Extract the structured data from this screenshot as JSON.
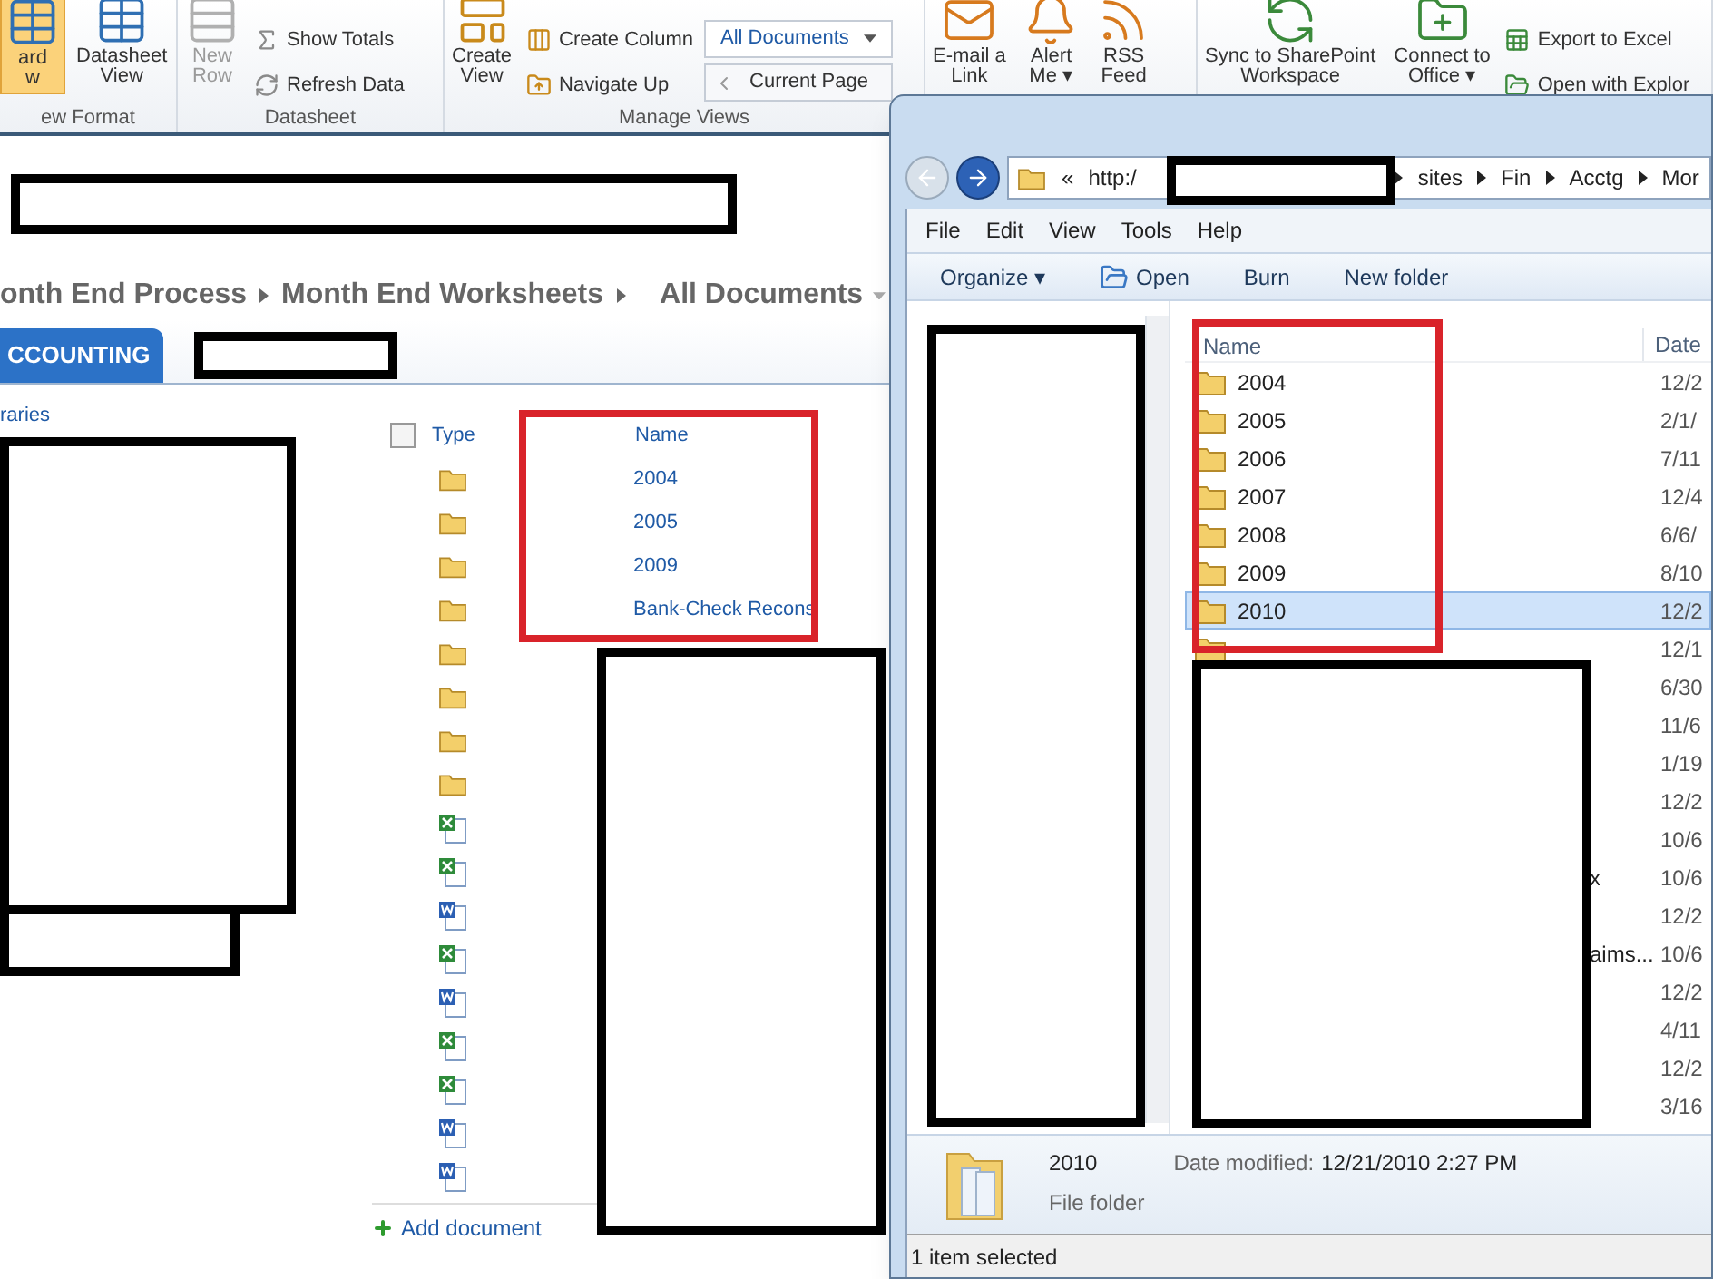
{
  "ribbon": {
    "groups": [
      {
        "label": "ew Format",
        "items": [
          {
            "kind": "large",
            "label": "ard\nw",
            "selected": true
          },
          {
            "kind": "large",
            "label": "Datasheet\nView",
            "selected": false
          }
        ]
      },
      {
        "label": "Datasheet",
        "items": [
          {
            "kind": "large",
            "label": "New\nRow",
            "disabled": true
          },
          {
            "kind": "stack",
            "entries": [
              {
                "label": "Show Totals"
              },
              {
                "label": "Refresh Data"
              }
            ]
          }
        ]
      },
      {
        "label": "Manage Views",
        "items": [
          {
            "kind": "large",
            "label": "Create\nView"
          },
          {
            "kind": "stack",
            "entries": [
              {
                "label": "Create Column"
              },
              {
                "label": "Navigate Up"
              }
            ]
          },
          {
            "kind": "views",
            "view": "All Documents",
            "page": "Current Page"
          }
        ]
      },
      {
        "items": [
          {
            "kind": "large",
            "label": "E-mail a\nLink"
          },
          {
            "kind": "large",
            "label": "Alert\nMe",
            "menu": "▾"
          },
          {
            "kind": "large",
            "label": "RSS\nFeed"
          }
        ]
      },
      {
        "items": [
          {
            "kind": "large",
            "label": "Sync to SharePoint\nWorkspace"
          },
          {
            "kind": "large",
            "label": "Connect to\nOffice",
            "menu": "▾"
          },
          {
            "kind": "stack",
            "entries": [
              {
                "label": "Export to Excel"
              },
              {
                "label": "Open with Explor"
              }
            ]
          }
        ]
      }
    ]
  },
  "breadcrumb": [
    "onth End Process",
    "Month End Worksheets",
    "All Documents"
  ],
  "tabs": [
    {
      "label": "CCOUNTING",
      "selected": true
    }
  ],
  "nav": {
    "label": "raries"
  },
  "library": {
    "select_all": {
      "checked": false
    },
    "columns": [
      "Type",
      "Name"
    ],
    "rows": [
      {
        "kind": "folder",
        "name": "2004"
      },
      {
        "kind": "folder",
        "name": "2005"
      },
      {
        "kind": "folder",
        "name": "2009"
      },
      {
        "kind": "folder",
        "name": "Bank-Check Recons"
      },
      {
        "kind": "folder"
      },
      {
        "kind": "folder"
      },
      {
        "kind": "folder"
      },
      {
        "kind": "folder"
      },
      {
        "kind": "excel"
      },
      {
        "kind": "excel"
      },
      {
        "kind": "word"
      },
      {
        "kind": "excel"
      },
      {
        "kind": "word"
      },
      {
        "kind": "excel"
      },
      {
        "kind": "excel"
      },
      {
        "kind": "word"
      },
      {
        "kind": "word"
      }
    ],
    "add": "Add document"
  },
  "explorer": {
    "address": {
      "prefix": "«",
      "scheme": "http:/",
      "parts": [
        "sites",
        "Fin",
        "Acctg",
        "Mor"
      ]
    },
    "menu": [
      "File",
      "Edit",
      "View",
      "Tools",
      "Help"
    ],
    "toolbar": [
      {
        "label": "Organize",
        "menu": "▾"
      },
      {
        "label": "Open"
      },
      {
        "label": "Burn"
      },
      {
        "label": "New folder"
      }
    ],
    "columns": [
      "Name",
      "Date"
    ],
    "rows": [
      {
        "kind": "folder",
        "name": "2004",
        "date": "12/2",
        "selected": false
      },
      {
        "kind": "folder",
        "name": "2005",
        "date": "2/1/",
        "selected": false
      },
      {
        "kind": "folder",
        "name": "2006",
        "date": "7/11",
        "selected": false
      },
      {
        "kind": "folder",
        "name": "2007",
        "date": "12/4",
        "selected": false
      },
      {
        "kind": "folder",
        "name": "2008",
        "date": "6/6/",
        "selected": false
      },
      {
        "kind": "folder",
        "name": "2009",
        "date": "8/10",
        "selected": false
      },
      {
        "kind": "folder",
        "name": "2010",
        "date": "12/2",
        "selected": true
      },
      {
        "kind": "folder",
        "date": "12/1",
        "selected": false
      },
      {
        "kind": "hidden",
        "date": "6/30",
        "selected": false
      },
      {
        "kind": "hidden",
        "date": "11/6",
        "selected": false
      },
      {
        "kind": "hidden",
        "date": "1/19",
        "selected": false
      },
      {
        "kind": "hidden",
        "date": "12/2",
        "selected": false
      },
      {
        "kind": "hidden",
        "date": "10/6",
        "selected": false
      },
      {
        "kind": "hidden",
        "name": "x",
        "date": "10/6",
        "selected": false
      },
      {
        "kind": "hidden",
        "date": "12/2",
        "selected": false
      },
      {
        "kind": "hidden",
        "name": "aims...",
        "date": "10/6",
        "selected": false
      },
      {
        "kind": "hidden",
        "date": "12/2",
        "selected": false
      },
      {
        "kind": "hidden",
        "date": "4/11",
        "selected": false
      },
      {
        "kind": "hidden",
        "date": "12/2",
        "selected": false
      },
      {
        "kind": "hidden",
        "date": "3/16",
        "selected": false
      }
    ],
    "details": {
      "name": "2010",
      "type": "File folder",
      "date_label": "Date modified:",
      "date": "12/21/2010 2:27 PM"
    },
    "status": "1 item selected"
  }
}
